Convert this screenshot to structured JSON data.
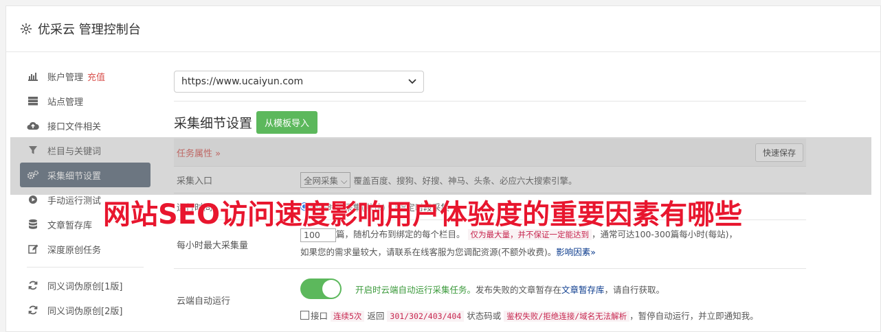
{
  "header": {
    "title": "优采云 管理控制台"
  },
  "sidebar": {
    "items": [
      {
        "label": "账户管理",
        "badge": "充值",
        "icon": "bar-chart-icon"
      },
      {
        "label": "站点管理",
        "icon": "server-icon"
      },
      {
        "label": "接口文件相关",
        "icon": "cloud-upload-icon"
      },
      {
        "label": "栏目与关键词",
        "icon": "filter-icon"
      },
      {
        "label": "采集细节设置",
        "icon": "gears-icon",
        "active": true
      },
      {
        "label": "手动运行测试",
        "icon": "play-circle-icon"
      },
      {
        "label": "文章暂存库",
        "icon": "database-icon"
      },
      {
        "label": "深度原创任务",
        "icon": "edit-icon"
      },
      {
        "label": "同义词伪原创[1版]",
        "icon": "refresh-icon"
      },
      {
        "label": "同义词伪原创[2版]",
        "icon": "refresh-icon"
      }
    ]
  },
  "main": {
    "site_select": "https://www.ucaiyun.com",
    "section_title": "采集细节设置",
    "import_button": "从模板导入",
    "task_attr_label": "任务属性 »",
    "quick_save": "快速保存",
    "rows": {
      "entry": {
        "label": "采集入口",
        "select": "全网采集",
        "desc": "覆盖百度、搜狗、好搜、神马、头条、必应六大搜索引擎。"
      },
      "runtime": {
        "label": "运行时间",
        "opt1": "全天时段采集(默认)",
        "opt2": "指定时段采集"
      },
      "max": {
        "label": "每小时最大采集量",
        "value": "100",
        "t1": "篇，随机分布到绑定的每个栏目。",
        "code": "仅为最大量，并不保证一定能达到",
        "t2": "，通常可达100-300篇每小时(每站)，",
        "t3": "如果您的需求量较大，请联系在线客服为您调配资源(不额外收费)。",
        "link": "影响因素"
      },
      "cloud": {
        "label": "云端自动运行",
        "green": "开启时云端自动运行采集任务。",
        "t1": "发布失败的文章暂存在",
        "link": "文章暂存库",
        "t2": "，请自行获取。",
        "c1": "接口",
        "code1": "连续5次",
        "c2": "返回",
        "code2": "301/302/403/404",
        "c3": "状态码或",
        "code3": "鉴权失败/拒绝连接/域名无法解析",
        "c4": "，暂停自动运行，并立即通知我。"
      }
    }
  },
  "banner": "网站SEO访问速度影响用户体验度的重要因素有哪些"
}
